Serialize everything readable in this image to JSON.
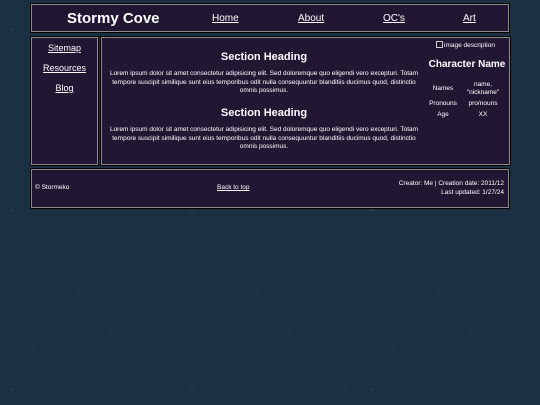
{
  "header": {
    "site_title": "Stormy Cove",
    "nav": [
      {
        "label": "Home"
      },
      {
        "label": "About"
      },
      {
        "label": "OC's"
      },
      {
        "label": "Art"
      }
    ]
  },
  "sidebar": {
    "items": [
      {
        "label": "Sitemap"
      },
      {
        "label": "Resources"
      },
      {
        "label": "Blog"
      }
    ]
  },
  "main": {
    "sections": [
      {
        "heading": "Section Heading",
        "body": "Lorem ipsum dolor sit amet consectetur adipisicing elit. Sed doloremque quo eligendi vero excepturi. Totam tempore suscipit similique sunt eius temporibus odit nulla consequuntur blanditiis ducimus quod, distinctio omnis possimus."
      },
      {
        "heading": "Section Heading",
        "body": "Lorem ipsum dolor sit amet consectetur adipisicing elit. Sed doloremque quo eligendi vero excepturi. Totam tempore suscipit similique sunt eius temporibus odit nulla consequuntur blanditiis ducimus quod, distinctio omnis possimus."
      }
    ]
  },
  "character": {
    "image_alt": "image description",
    "name": "Character Name",
    "rows": [
      {
        "label": "Names",
        "value": "name, \"nickname\""
      },
      {
        "label": "Pronouns",
        "value": "pro/nouns"
      },
      {
        "label": "Age",
        "value": "XX"
      }
    ]
  },
  "footer": {
    "copyright": "© Stormeko",
    "back_to_top": "Back to top",
    "creator_line": "Creator: Me | Creation date: 2011/12",
    "updated_line": "Last updated: 1/27/24"
  },
  "colors": {
    "page_background": "#1b3042",
    "panel_background": "#211733",
    "panel_border": "#8a8a8a",
    "text": "#ffffff"
  }
}
